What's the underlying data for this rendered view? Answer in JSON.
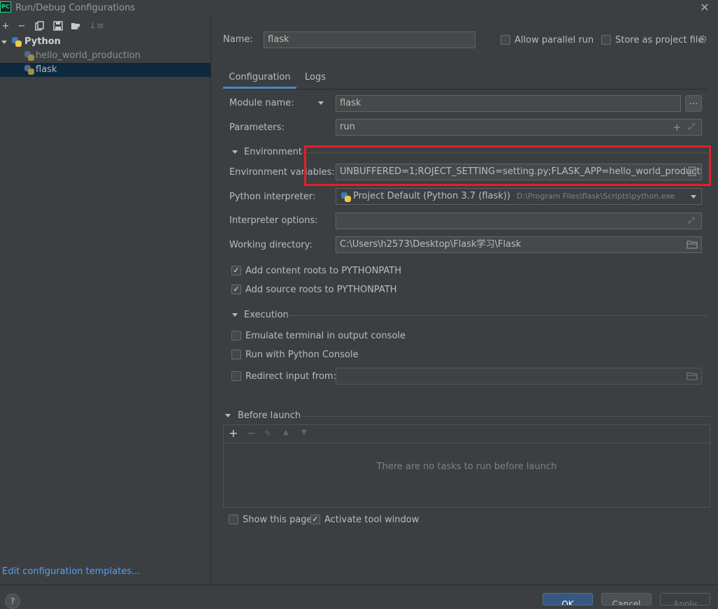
{
  "window": {
    "title": "Run/Debug Configurations",
    "app_icon_text": "PC"
  },
  "left_toolbar": {
    "icons": [
      "add-icon",
      "remove-icon",
      "copy-icon",
      "save-icon",
      "move-to-folder-icon",
      "sort-icon"
    ]
  },
  "tree": {
    "group_label": "Python",
    "items": [
      {
        "label": "hello_world_production",
        "selected": false
      },
      {
        "label": "flask",
        "selected": true
      }
    ]
  },
  "edit_templates_label": "Edit configuration templates...",
  "header": {
    "name_label": "Name:",
    "name_value": "flask",
    "allow_parallel_label": "Allow parallel run",
    "allow_parallel_checked": false,
    "store_project_label": "Store as project file",
    "store_project_checked": false
  },
  "tabs": [
    {
      "label": "Configuration",
      "active": true
    },
    {
      "label": "Logs",
      "active": false
    }
  ],
  "form": {
    "module_name_label": "Module name:",
    "module_name_value": "flask",
    "browse_label": "...",
    "parameters_label": "Parameters:",
    "parameters_value": "run",
    "environment_section": "Environment",
    "env_vars_label": "Environment variables:",
    "env_vars_value": "UNBUFFERED=1;ROJECT_SETTING=setting.py;FLASK_APP=hello_world_production.py",
    "interpreter_label": "Python interpreter:",
    "interpreter_value": "Project Default (Python 3.7 (flask))",
    "interpreter_path": "D:\\Program Files\\flask\\Scripts\\python.exe",
    "interpreter_options_label": "Interpreter options:",
    "interpreter_options_value": "",
    "working_dir_label": "Working directory:",
    "working_dir_value": "C:\\Users\\h2573\\Desktop\\Flask学习\\Flask",
    "content_roots_label": "Add content roots to PYTHONPATH",
    "content_roots_checked": true,
    "source_roots_label": "Add source roots to PYTHONPATH",
    "source_roots_checked": true,
    "execution_section": "Execution",
    "emulate_terminal_label": "Emulate terminal in output console",
    "emulate_terminal_checked": false,
    "python_console_label": "Run with Python Console",
    "python_console_checked": false,
    "redirect_input_label": "Redirect input from:",
    "redirect_input_checked": false,
    "redirect_input_value": ""
  },
  "before_launch": {
    "section": "Before launch",
    "empty_message": "There are no tasks to run before launch"
  },
  "footer_options": {
    "show_page_label": "Show this page",
    "show_page_checked": false,
    "activate_tool_label": "Activate tool window",
    "activate_tool_checked": true
  },
  "buttons": {
    "help": "?",
    "ok": "OK",
    "cancel": "Cancel",
    "apply": "Apply"
  },
  "colors": {
    "background": "#3c3f41",
    "selection": "#0d293e",
    "accent": "#4a88c7",
    "link": "#589df6",
    "highlight_box": "#e0202a"
  }
}
